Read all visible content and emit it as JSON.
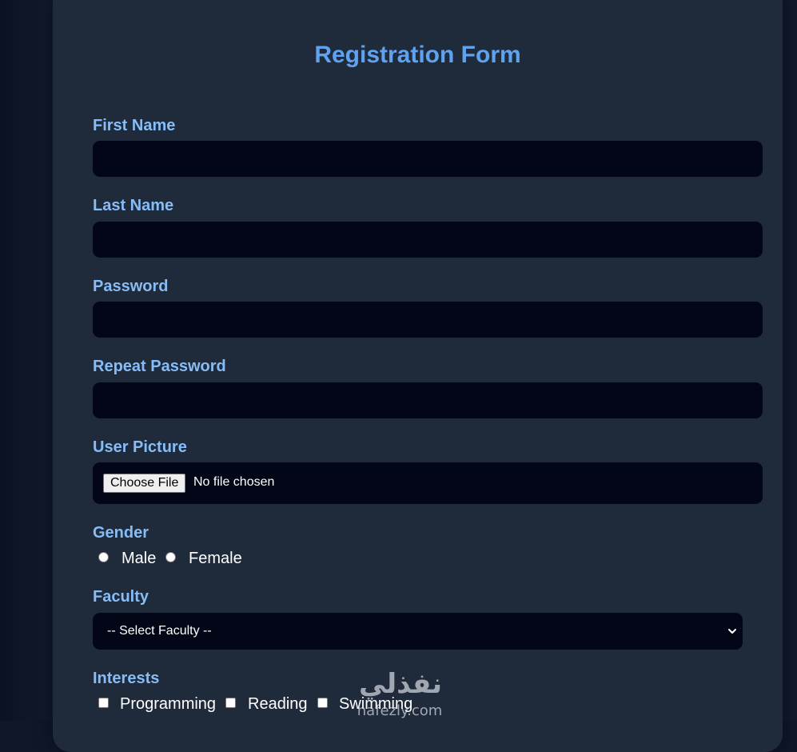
{
  "form": {
    "title": "Registration Form"
  },
  "fields": {
    "first_name": {
      "label": "First Name",
      "value": ""
    },
    "last_name": {
      "label": "Last Name",
      "value": ""
    },
    "password": {
      "label": "Password",
      "value": ""
    },
    "repeat_password": {
      "label": "Repeat Password",
      "value": ""
    },
    "user_picture": {
      "label": "User Picture",
      "button_label": "Choose File",
      "status": "No file chosen"
    },
    "gender": {
      "label": "Gender",
      "options": [
        "Male",
        "Female"
      ]
    },
    "faculty": {
      "label": "Faculty",
      "selected": "-- Select Faculty --"
    },
    "interests": {
      "label": "Interests",
      "options": [
        "Programming",
        "Reading",
        "Swimming"
      ]
    }
  },
  "watermark": {
    "arabic_text": "نفذلي",
    "latin_text": "nafezly.com"
  },
  "colors": {
    "title": "#5fa3f0",
    "label": "#86bdf7",
    "card": "#1f2a3b",
    "input": "#020617",
    "background": "#111a2c"
  },
  "icons": {
    "select_arrow": "chevron-down-icon"
  }
}
